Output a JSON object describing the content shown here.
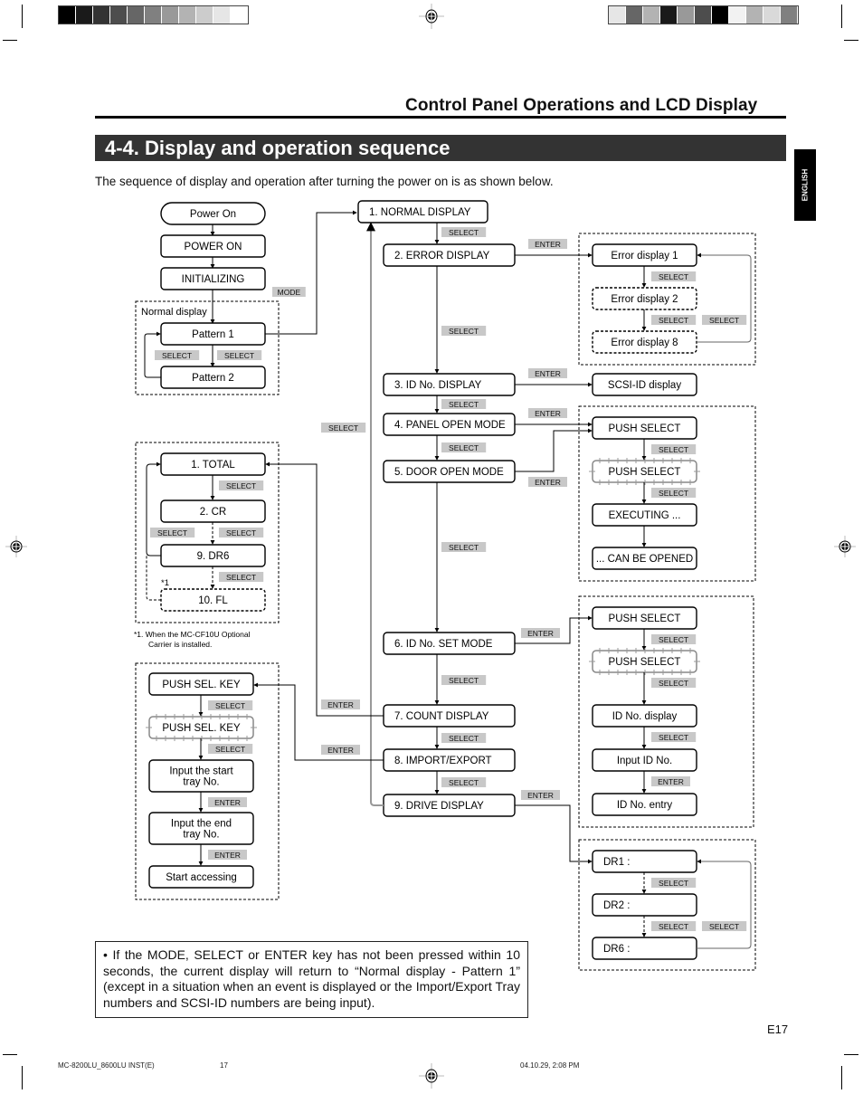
{
  "registration": {
    "left_swatches": [
      "#000000",
      "#1a1a1a",
      "#333333",
      "#4d4d4d",
      "#666666",
      "#808080",
      "#999999",
      "#b3b3b3",
      "#cccccc",
      "#e6e6e6",
      "#ffffff"
    ],
    "right_swatches": [
      "#e6e6e6",
      "#666666",
      "#b3b3b3",
      "#1a1a1a",
      "#999999",
      "#4d4d4d",
      "#000000",
      "#f2f2f2",
      "#b3b3b3",
      "#d9d9d9",
      "#808080"
    ]
  },
  "header": {
    "section_title": "Control Panel Operations and LCD Display",
    "banner_title": "4-4. Display and operation sequence",
    "language_tab": "ENGLISH"
  },
  "intro": "The sequence of display and operation after turning the power on is as shown below.",
  "diagram": {
    "startup": {
      "power_on_oval": "Power On",
      "power_on_box": "POWER ON",
      "initializing": "INITIALIZING",
      "group_label": "Normal display",
      "pattern1": "Pattern 1",
      "pattern2": "Pattern 2",
      "mode_key": "MODE"
    },
    "main": [
      "1. NORMAL DISPLAY",
      "2. ERROR DISPLAY",
      "3. ID No. DISPLAY",
      "4. PANEL OPEN MODE",
      "5. DOOR OPEN MODE",
      "6. ID No. SET MODE",
      "7. COUNT DISPLAY",
      "8. IMPORT/EXPORT",
      "9. DRIVE DISPLAY"
    ],
    "error_group": [
      "Error display 1",
      "Error display 2",
      "Error display 8"
    ],
    "scsi": "SCSI-ID display",
    "door_group": [
      "PUSH SELECT",
      "PUSH SELECT",
      "EXECUTING ...",
      "... CAN BE OPENED"
    ],
    "idset_group": [
      "PUSH SELECT",
      "PUSH SELECT",
      "ID No. display",
      "Input ID No.",
      "ID No. entry"
    ],
    "drive_group": [
      "DR1 :",
      "DR2 :",
      "DR6 :"
    ],
    "count_group": [
      "1. TOTAL",
      "2. CR",
      "9. DR6",
      "10. FL"
    ],
    "count_footnote_mark": "*1",
    "count_footnote": [
      "*1.  When the MC-CF10U Optional",
      "Carrier is installed."
    ],
    "import_group": [
      "PUSH SEL. KEY",
      "PUSH SEL. KEY",
      "Input the start",
      "tray No.",
      "Input the end",
      "tray No.",
      "Start accessing"
    ],
    "keys": {
      "select": "SELECT",
      "enter": "ENTER",
      "mode": "MODE"
    }
  },
  "note": "• If the MODE, SELECT or ENTER key has not been pressed within 10 seconds, the current display will return to “Normal display - Pattern 1” (except in a situation when an event is displayed or the Import/Export Tray numbers and SCSI-ID numbers are being input).",
  "page_number": "E17",
  "footer": {
    "file": "MC-8200LU_8600LU INST(E)",
    "page": "17",
    "timestamp": "04.10.29, 2:08 PM"
  }
}
